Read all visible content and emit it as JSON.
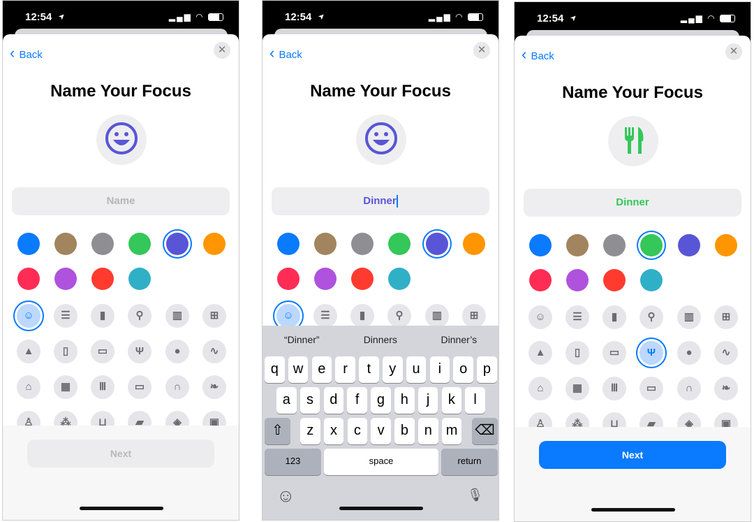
{
  "status": {
    "time": "12:54",
    "location_icon": "location-arrow-icon",
    "signal_icon": "signal-icon",
    "wifi_icon": "wifi-icon",
    "battery_icon": "battery-icon"
  },
  "colors": [
    "#0a7aff",
    "#a2845e",
    "#8e8e93",
    "#34c759",
    "#5856d6",
    "#ff9500",
    "#ff2d55",
    "#af52de",
    "#ff3b30",
    "#30b0c7"
  ],
  "icons": [
    {
      "name": "smiley-icon",
      "glyph": "☺"
    },
    {
      "name": "list-icon",
      "glyph": "☰"
    },
    {
      "name": "bookmark-icon",
      "glyph": "▮"
    },
    {
      "name": "pin-icon",
      "glyph": "⚲"
    },
    {
      "name": "books-icon",
      "glyph": "▥"
    },
    {
      "name": "gift-icon",
      "glyph": "⊞"
    },
    {
      "name": "graduation-cap-icon",
      "glyph": "▲"
    },
    {
      "name": "document-icon",
      "glyph": "▯"
    },
    {
      "name": "credit-card-icon",
      "glyph": "▭"
    },
    {
      "name": "fork-knife-icon",
      "glyph": "Ψ"
    },
    {
      "name": "pills-icon",
      "glyph": "●"
    },
    {
      "name": "stethoscope-icon",
      "glyph": "∿"
    },
    {
      "name": "house-icon",
      "glyph": "⌂"
    },
    {
      "name": "building-icon",
      "glyph": "▦"
    },
    {
      "name": "bank-icon",
      "glyph": "Ⅲ"
    },
    {
      "name": "monitor-icon",
      "glyph": "▭"
    },
    {
      "name": "headphones-icon",
      "glyph": "∩"
    },
    {
      "name": "leaf-icon",
      "glyph": "❧"
    },
    {
      "name": "person-icon",
      "glyph": "♙"
    },
    {
      "name": "paw-icon",
      "glyph": "⁂"
    },
    {
      "name": "cart-icon",
      "glyph": "⊔"
    },
    {
      "name": "bag-icon",
      "glyph": "▰"
    },
    {
      "name": "box-icon",
      "glyph": "◈"
    },
    {
      "name": "bus-icon",
      "glyph": "▣"
    }
  ],
  "screens": [
    {
      "back": "Back",
      "title": "Name Your Focus",
      "field_value": "",
      "field_placeholder": "Name",
      "field_color": "#b5b5ba",
      "selected_color": 4,
      "selected_icon": 0,
      "big_icon": "smiley-icon",
      "big_color": "#5856d6",
      "next": "Next",
      "next_enabled": false
    },
    {
      "back": "Back",
      "title": "Name Your Focus",
      "field_value": "Dinner",
      "field_color": "#5856d6",
      "selected_color": 4,
      "selected_icon": 0,
      "big_icon": "smiley-icon",
      "big_color": "#5856d6",
      "keyboard": true
    },
    {
      "back": "Back",
      "title": "Name Your Focus",
      "field_value": "Dinner",
      "field_color": "#34c759",
      "selected_color": 3,
      "selected_icon": 9,
      "big_icon": "fork-knife-icon",
      "big_color": "#34c759",
      "next": "Next",
      "next_enabled": true
    }
  ],
  "keyboard": {
    "suggestions": [
      "“Dinner”",
      "Dinners",
      "Dinner’s"
    ],
    "row1": [
      "q",
      "w",
      "e",
      "r",
      "t",
      "y",
      "u",
      "i",
      "o",
      "p"
    ],
    "row2": [
      "a",
      "s",
      "d",
      "f",
      "g",
      "h",
      "j",
      "k",
      "l"
    ],
    "row3": [
      "z",
      "x",
      "c",
      "v",
      "b",
      "n",
      "m"
    ],
    "numbers": "123",
    "space": "space",
    "return": "return",
    "shift_icon": "shift-icon",
    "delete_icon": "delete-icon",
    "emoji_icon": "emoji-icon",
    "mic_icon": "microphone-icon"
  }
}
